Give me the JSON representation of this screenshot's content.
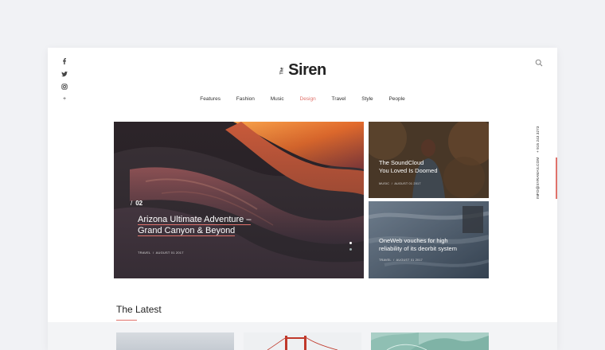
{
  "brand": {
    "the": "The",
    "name": "Siren"
  },
  "nav": [
    {
      "label": "Features",
      "active": false
    },
    {
      "label": "Fashion",
      "active": false
    },
    {
      "label": "Music",
      "active": false
    },
    {
      "label": "Design",
      "active": true
    },
    {
      "label": "Travel",
      "active": false
    },
    {
      "label": "Style",
      "active": false
    },
    {
      "label": "People",
      "active": false
    }
  ],
  "social": {
    "facebook": "facebook-icon",
    "twitter": "twitter-icon",
    "instagram": "instagram-icon",
    "more": "+"
  },
  "contact": {
    "phone": "+ 915 243 3273",
    "email": "INFO@SYRAMAS.COM"
  },
  "hero": {
    "number": "02",
    "title_line1": "Arizona Ultimate Adventure –",
    "title_line2": "Grand Canyon & Beyond",
    "category": "TRAVEL",
    "date": "AUGUST 01 2017",
    "slides": 2,
    "active_slide": 1
  },
  "cards": [
    {
      "title_line1": "The SoundCloud",
      "title_line2": "You Loved Is Doomed",
      "category": "MUSIC",
      "date": "AUGUST 01 2017"
    },
    {
      "title_line1": "OneWeb vouches for high",
      "title_line2": "reliability of its deorbit system",
      "category": "TRAVEL",
      "date": "AUGUST 01 2017"
    }
  ],
  "latest": {
    "heading": "The Latest"
  },
  "colors": {
    "accent": "#e0726b",
    "background": "#f1f2f5"
  }
}
